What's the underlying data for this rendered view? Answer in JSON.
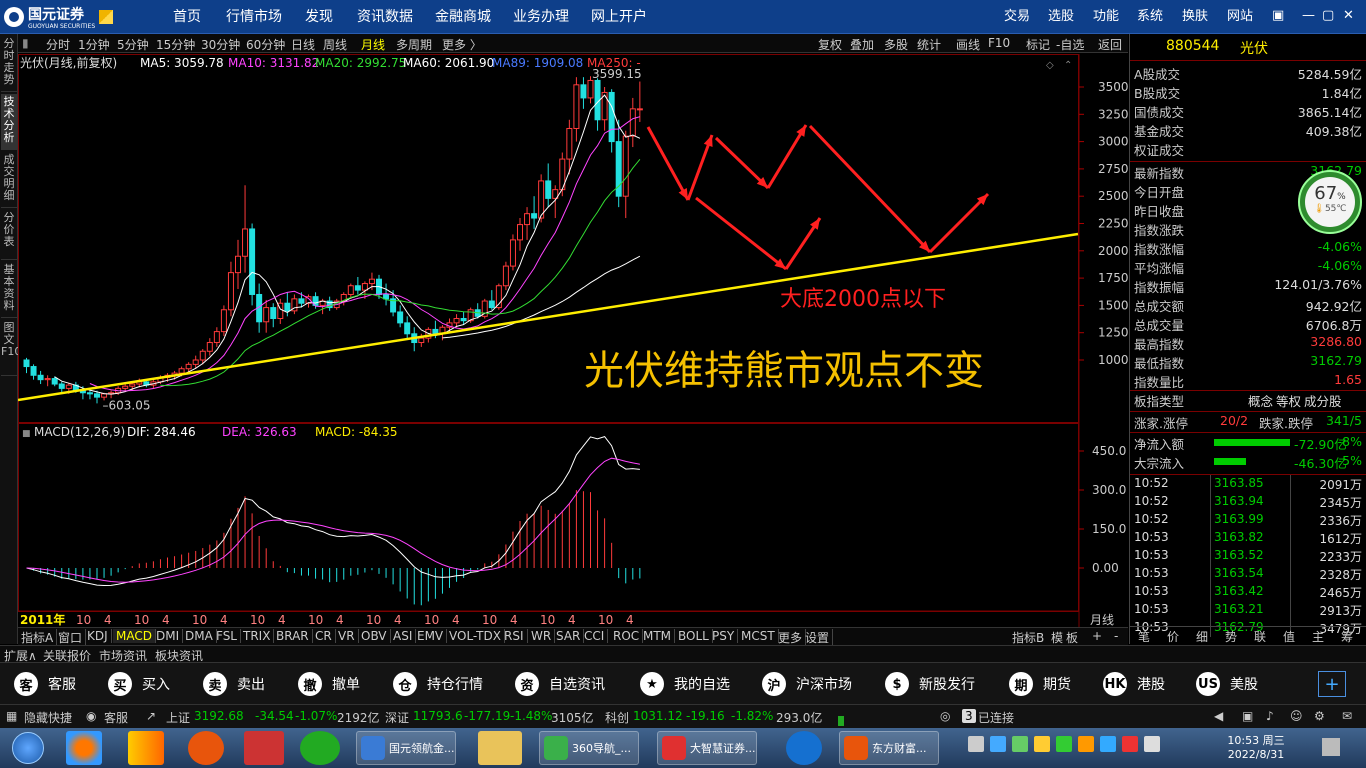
{
  "app": {
    "logo_name": "国元证券",
    "logo_en": "GUOYUAN SECURITIES"
  },
  "topnav": [
    "首页",
    "行情市场",
    "发现",
    "资讯数据",
    "金融商城",
    "业务办理",
    "网上开户"
  ],
  "topright": [
    "交易",
    "选股",
    "功能",
    "系统",
    "换肤",
    "网站"
  ],
  "lefttabs": [
    "分时走势",
    "技术分析",
    "成交明细",
    "分价表",
    "基本资料",
    "图文F10"
  ],
  "periods": [
    "分时",
    "1分钟",
    "5分钟",
    "15分钟",
    "30分钟",
    "60分钟",
    "日线",
    "周线",
    "月线",
    "多周期",
    "更多 〉"
  ],
  "period_active": "月线",
  "rightmenu": [
    "复权",
    "叠加",
    "多股",
    "统计",
    "画线",
    "F10",
    "标记",
    "-自选",
    "返回"
  ],
  "chart_title": "光伏(月线,前复权)",
  "ma": [
    {
      "label": "MA5: 3059.78",
      "color": "#ffffff"
    },
    {
      "label": "MA10: 3131.82",
      "color": "#ff44ff"
    },
    {
      "label": "MA20: 2992.75",
      "color": "#33dd33"
    },
    {
      "label": "MA60: 2061.90",
      "color": "#ffffff"
    },
    {
      "label": "MA89: 1909.08",
      "color": "#4a7aff"
    },
    {
      "label": "MA250: -",
      "color": "#ff3b3b"
    }
  ],
  "price_axis": [
    "3500",
    "3250",
    "3000",
    "2750",
    "2500",
    "2250",
    "2000",
    "1750",
    "1500",
    "1250",
    "1000"
  ],
  "macd_axis": [
    "450.0",
    "300.0",
    "150.0",
    "0.00"
  ],
  "macd_title": "MACD(12,26,9)",
  "macd_dif": "DIF: 284.46",
  "macd_dea": "DEA: 326.63",
  "macd_val": "MACD: -84.35",
  "high_label": "3599.15",
  "low_label": "603.05",
  "annot1": "大底2000点以下",
  "annot2": "光伏维持熊市观点不变",
  "time_axis": [
    "2011年",
    "10",
    "4",
    "10",
    "4",
    "10",
    "4",
    "10",
    "4",
    "10",
    "4",
    "10",
    "4",
    "10",
    "4",
    "10",
    "4",
    "10",
    "4",
    "10",
    "4"
  ],
  "month_line": "月线",
  "indicators": [
    "指标A",
    "窗口",
    "KDJ",
    "MACD",
    "DMI",
    "DMA",
    "FSL",
    "TRIX",
    "BRAR",
    "CR",
    "VR",
    "OBV",
    "ASI",
    "EMV",
    "VOL-TDX",
    "RSI",
    "WR",
    "SAR",
    "CCI",
    "ROC",
    "MTM",
    "BOLL",
    "PSY",
    "MCST",
    "更多",
    "设置"
  ],
  "indicator_active": "MACD",
  "ind_right": [
    "指标B",
    "模",
    "板",
    "+",
    "-"
  ],
  "panel": {
    "code": "880544",
    "name": "光伏",
    "rows1": [
      [
        "A股成交",
        "5284.59亿"
      ],
      [
        "B股成交",
        "1.84亿"
      ],
      [
        "国债成交",
        "3865.14亿"
      ],
      [
        "基金成交",
        "409.38亿"
      ],
      [
        "权证成交",
        ""
      ]
    ],
    "rows2": [
      [
        "最新指数",
        "3162.79",
        "#00cc00"
      ],
      [
        "今日开盘",
        "",
        ""
      ],
      [
        "昨日收盘",
        "",
        ""
      ],
      [
        "指数涨跌",
        "",
        ""
      ],
      [
        "指数涨幅",
        "-4.06%",
        "#00cc00"
      ],
      [
        "平均涨幅",
        "-4.06%",
        "#00cc00"
      ],
      [
        "指数振幅",
        "124.01/3.76%",
        "#dddddd"
      ],
      [
        "总成交额",
        "942.92亿",
        "#dddddd"
      ],
      [
        "总成交量",
        "6706.8万",
        "#dddddd"
      ],
      [
        "最高指数",
        "3286.80",
        "#ff3b3b"
      ],
      [
        "最低指数",
        "3162.79",
        "#00cc00"
      ],
      [
        "指数量比",
        "1.65",
        "#ff3b3b"
      ]
    ],
    "sector_label": "板指类型",
    "sector_tags": [
      "概念",
      "等权",
      "成分股"
    ],
    "updown_label": "涨家.涨停",
    "updown_val": "20/2",
    "down_label": "跌家.跌停",
    "down_val": "341/5",
    "netflow_label": "净流入额",
    "netflow_val": "-72.90亿",
    "netflow_pct": "-8%",
    "bigflow_label": "大宗流入",
    "bigflow_val": "-46.30亿",
    "bigflow_pct": "-5%",
    "ticks": [
      [
        "10:52",
        "3163.85",
        "2091万"
      ],
      [
        "10:52",
        "3163.94",
        "2345万"
      ],
      [
        "10:52",
        "3163.99",
        "2336万"
      ],
      [
        "10:53",
        "3163.82",
        "1612万"
      ],
      [
        "10:53",
        "3163.52",
        "2233万"
      ],
      [
        "10:53",
        "3163.54",
        "2328万"
      ],
      [
        "10:53",
        "3163.42",
        "2465万"
      ],
      [
        "10:53",
        "3163.21",
        "2913万"
      ],
      [
        "10:53",
        "3162.79",
        "3479万"
      ]
    ],
    "tabs": [
      "笔",
      "价",
      "细",
      "势",
      "联",
      "值",
      "主",
      "筹"
    ]
  },
  "gauge": {
    "pct": "67",
    "unit": "%",
    "temp": "55℃"
  },
  "statusbar": [
    "扩展∧",
    "关联报价",
    "市场资讯",
    "板块资讯"
  ],
  "quickbar": [
    [
      "客",
      "客服"
    ],
    [
      "买",
      "买入"
    ],
    [
      "卖",
      "卖出"
    ],
    [
      "撤",
      "撤单"
    ],
    [
      "仓",
      "持仓行情"
    ],
    [
      "资",
      "自选资讯"
    ],
    [
      "★",
      "我的自选"
    ],
    [
      "沪",
      "沪深市场"
    ],
    [
      "$",
      "新股发行"
    ],
    [
      "期",
      "期货"
    ],
    [
      "HK",
      "港股"
    ],
    [
      "US",
      "美股"
    ]
  ],
  "indexbar": {
    "hide": "隐藏快捷",
    "service": "客服",
    "sh": [
      "上证",
      "3192.68",
      "-34.54",
      "-1.07%",
      "2192亿"
    ],
    "sz": [
      "深证",
      "11793.6",
      "-177.19",
      "-1.48%",
      "3105亿"
    ],
    "kc": [
      "科创",
      "1031.12",
      "-19.16",
      "-1.82%",
      "293.0亿"
    ],
    "conn_count": "3",
    "conn": "已连接"
  },
  "taskbar": {
    "windows": [
      "国元领航金...",
      "360导航_...",
      "大智慧证券...",
      "东方财富..."
    ],
    "time": "10:53 周三",
    "date": "2022/8/31"
  },
  "chart_data": {
    "type": "candlestick",
    "title": "光伏(月线,前复权)",
    "ylim": [
      600,
      3650
    ],
    "x_start": "2011年",
    "high": 3599.15,
    "low": 603.05,
    "candles": [
      [
        1000,
        1020,
        880,
        940
      ],
      [
        940,
        960,
        820,
        860
      ],
      [
        860,
        900,
        780,
        820
      ],
      [
        820,
        860,
        760,
        830
      ],
      [
        830,
        850,
        760,
        780
      ],
      [
        780,
        800,
        700,
        740
      ],
      [
        740,
        790,
        690,
        770
      ],
      [
        770,
        800,
        700,
        720
      ],
      [
        720,
        760,
        640,
        700
      ],
      [
        700,
        740,
        640,
        690
      ],
      [
        690,
        720,
        603,
        660
      ],
      [
        660,
        700,
        630,
        690
      ],
      [
        690,
        720,
        650,
        700
      ],
      [
        700,
        760,
        680,
        740
      ],
      [
        740,
        790,
        710,
        760
      ],
      [
        760,
        800,
        720,
        780
      ],
      [
        780,
        830,
        750,
        800
      ],
      [
        800,
        820,
        750,
        770
      ],
      [
        770,
        820,
        740,
        800
      ],
      [
        800,
        860,
        780,
        840
      ],
      [
        840,
        880,
        800,
        860
      ],
      [
        860,
        900,
        820,
        880
      ],
      [
        880,
        940,
        850,
        920
      ],
      [
        920,
        980,
        880,
        960
      ],
      [
        960,
        1040,
        920,
        1000
      ],
      [
        1000,
        1100,
        960,
        1080
      ],
      [
        1080,
        1200,
        1040,
        1160
      ],
      [
        1160,
        1300,
        1120,
        1260
      ],
      [
        1260,
        1500,
        1220,
        1460
      ],
      [
        1460,
        1900,
        1400,
        1800
      ],
      [
        1800,
        2100,
        1650,
        1950
      ],
      [
        1950,
        2600,
        1800,
        2200
      ],
      [
        2200,
        2250,
        1500,
        1600
      ],
      [
        1600,
        1700,
        1250,
        1350
      ],
      [
        1350,
        1550,
        1250,
        1480
      ],
      [
        1480,
        1520,
        1300,
        1380
      ],
      [
        1380,
        1560,
        1330,
        1520
      ],
      [
        1520,
        1620,
        1400,
        1450
      ],
      [
        1450,
        1600,
        1420,
        1560
      ],
      [
        1560,
        1620,
        1480,
        1520
      ],
      [
        1520,
        1600,
        1480,
        1580
      ],
      [
        1580,
        1620,
        1470,
        1500
      ],
      [
        1500,
        1560,
        1420,
        1540
      ],
      [
        1540,
        1580,
        1450,
        1480
      ],
      [
        1480,
        1560,
        1460,
        1540
      ],
      [
        1540,
        1620,
        1500,
        1600
      ],
      [
        1600,
        1700,
        1560,
        1680
      ],
      [
        1680,
        1760,
        1600,
        1640
      ],
      [
        1640,
        1720,
        1560,
        1700
      ],
      [
        1700,
        1800,
        1640,
        1740
      ],
      [
        1740,
        1780,
        1560,
        1600
      ],
      [
        1600,
        1700,
        1500,
        1560
      ],
      [
        1560,
        1640,
        1400,
        1440
      ],
      [
        1440,
        1500,
        1300,
        1340
      ],
      [
        1340,
        1400,
        1200,
        1240
      ],
      [
        1240,
        1300,
        1080,
        1160
      ],
      [
        1160,
        1240,
        1120,
        1200
      ],
      [
        1200,
        1300,
        1160,
        1280
      ],
      [
        1280,
        1360,
        1200,
        1240
      ],
      [
        1240,
        1320,
        1180,
        1300
      ],
      [
        1300,
        1380,
        1250,
        1340
      ],
      [
        1340,
        1420,
        1300,
        1380
      ],
      [
        1380,
        1440,
        1320,
        1360
      ],
      [
        1360,
        1480,
        1340,
        1460
      ],
      [
        1460,
        1520,
        1380,
        1400
      ],
      [
        1400,
        1560,
        1380,
        1540
      ],
      [
        1540,
        1640,
        1460,
        1480
      ],
      [
        1480,
        1700,
        1460,
        1680
      ],
      [
        1680,
        1900,
        1640,
        1860
      ],
      [
        1860,
        2150,
        1820,
        2100
      ],
      [
        2100,
        2300,
        2000,
        2240
      ],
      [
        2240,
        2400,
        2100,
        2340
      ],
      [
        2340,
        2500,
        2200,
        2300
      ],
      [
        2300,
        2700,
        2260,
        2640
      ],
      [
        2640,
        2800,
        2400,
        2480
      ],
      [
        2480,
        2600,
        2300,
        2560
      ],
      [
        2560,
        2900,
        2500,
        2840
      ],
      [
        2840,
        3200,
        2700,
        3120
      ],
      [
        3120,
        3590,
        3000,
        3520
      ],
      [
        3520,
        3590,
        3300,
        3400
      ],
      [
        3400,
        3599,
        3350,
        3560
      ],
      [
        3560,
        3580,
        3100,
        3200
      ],
      [
        3200,
        3500,
        3100,
        3450
      ],
      [
        3450,
        3480,
        2900,
        3000
      ],
      [
        3000,
        3200,
        2400,
        2500
      ],
      [
        2500,
        3100,
        2300,
        3050
      ],
      [
        3050,
        3400,
        2950,
        3300
      ],
      [
        3300,
        3550,
        3180,
        3300
      ]
    ],
    "macd_axis": [
      0,
      150,
      300,
      450
    ],
    "macd_dif": 284.46,
    "macd_dea": 326.63,
    "macd": -84.35
  }
}
